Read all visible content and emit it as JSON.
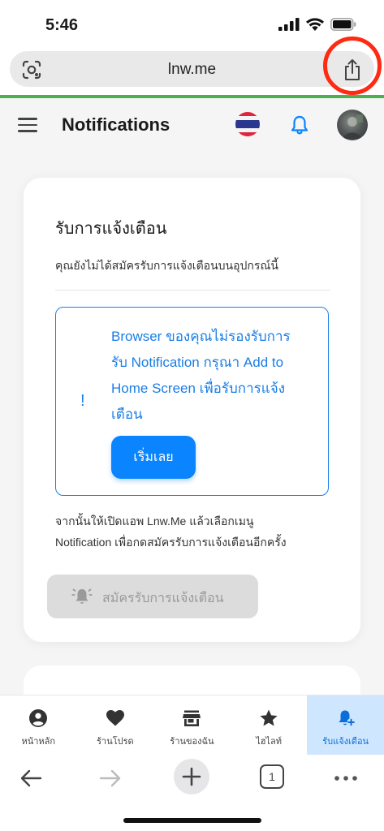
{
  "status": {
    "time": "5:46"
  },
  "browser": {
    "url": "lnw.me"
  },
  "header": {
    "title": "Notifications"
  },
  "card": {
    "title": "รับการแจ้งเตือน",
    "subtitle": "คุณยังไม่ได้สมัครรับการแจ้งเตือนบนอุปกรณ์นี้",
    "info_lines": [
      "Browser ของคุณไม่รองรับการ",
      "รับ Notification กรุณา Add to",
      "Home Screen เพื่อรับการแจ้ง",
      "เตือน"
    ],
    "info_mark": "!",
    "start_label": "เริ่มเลย",
    "after_lines": [
      "จากนั้นให้เปิดแอพ Lnw.Me แล้วเลือกเมนู",
      "Notification เพื่อกดสมัครรับการแจ้งเตือนอีกครั้ง"
    ],
    "subscribe_label": "สมัครรับการแจ้งเตือน"
  },
  "nav": {
    "items": [
      {
        "label": "หน้าหลัก",
        "icon": "account-circle-icon"
      },
      {
        "label": "ร้านโปรด",
        "icon": "heart-icon"
      },
      {
        "label": "ร้านของฉัน",
        "icon": "store-icon"
      },
      {
        "label": "ไฮไลท์",
        "icon": "star-icon"
      },
      {
        "label": "รับแจ้งเตือน",
        "icon": "bell-plus-icon"
      }
    ],
    "active_index": 4
  },
  "toolbar": {
    "tab_count": "1"
  },
  "colors": {
    "accent": "#0a84ff",
    "info_blue": "#1a7ee6",
    "highlight_ring": "#ff2a12",
    "progress_green": "#4caf50",
    "active_nav_bg": "#cfe6ff"
  }
}
